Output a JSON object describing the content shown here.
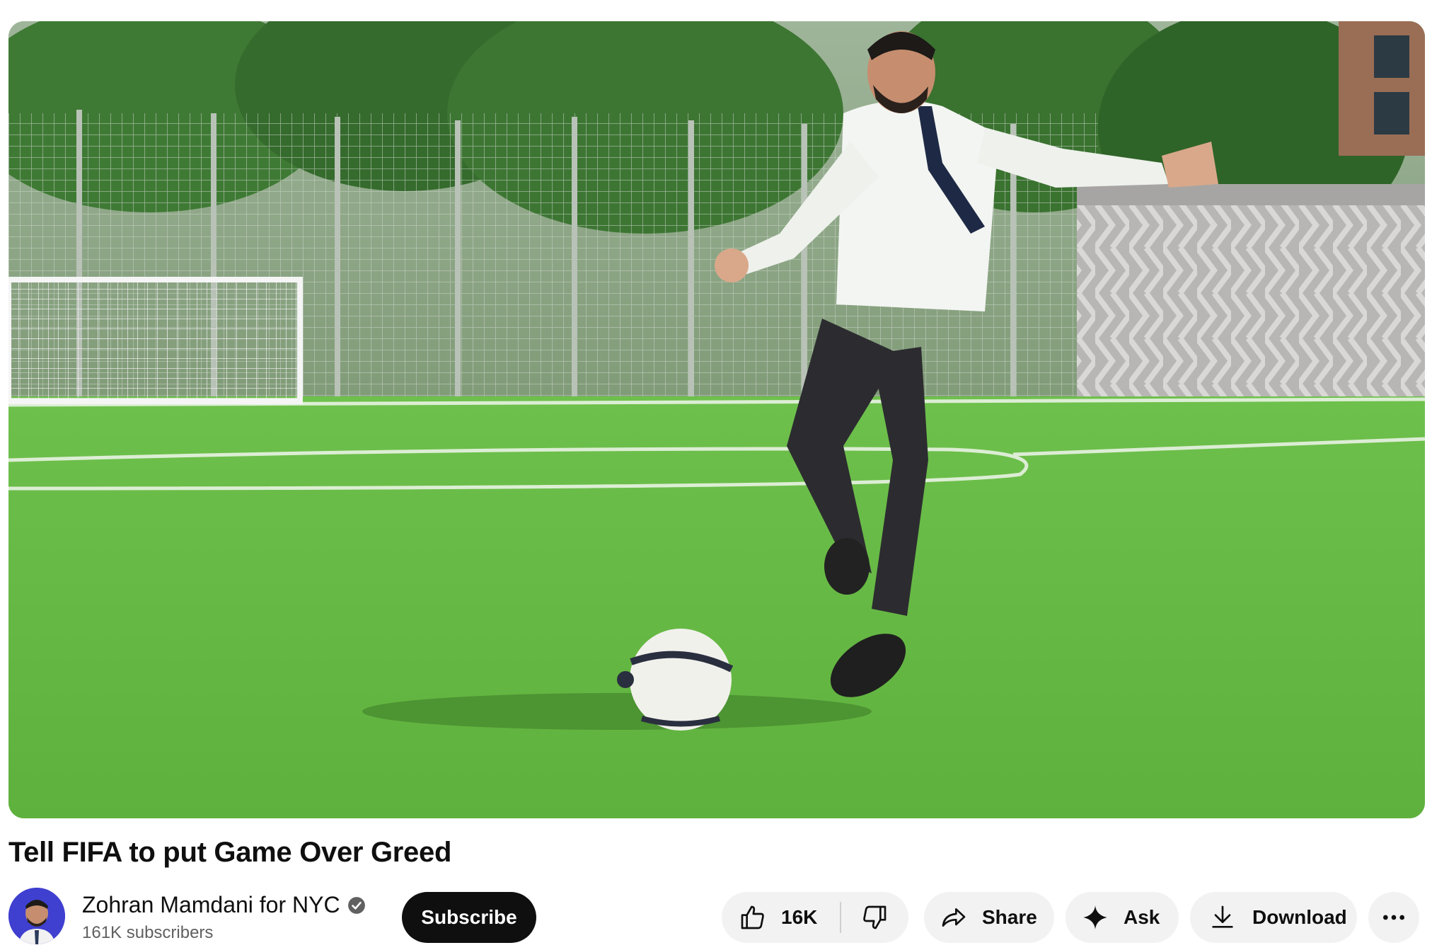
{
  "video": {
    "title": "Tell FIFA to put Game Over Greed",
    "thumbnail_description_icon": "video-frame"
  },
  "channel": {
    "name": "Zohran Mamdani for NYC",
    "verified": true,
    "subscribers": "161K subscribers",
    "avatar_color": "#3f3fd0"
  },
  "actions": {
    "subscribe_label": "Subscribe",
    "like_count": "16K",
    "share_label": "Share",
    "ask_label": "Ask",
    "download_label": "Download"
  },
  "colors": {
    "subscribe_bg": "#0f0f0f",
    "pill_bg": "#f2f2f2",
    "grass": "#6fbf4f"
  }
}
